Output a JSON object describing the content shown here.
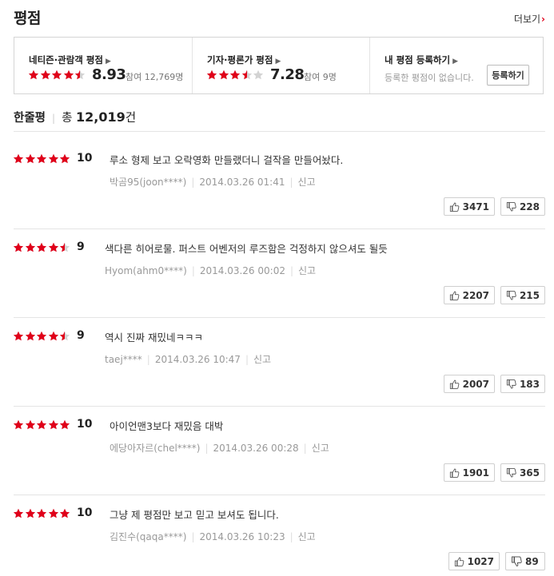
{
  "header": {
    "title": "평점",
    "more_label": "더보기",
    "more_arrow": "›"
  },
  "summary": {
    "netizen": {
      "label": "네티즌·관람객 평점",
      "score": "8.93",
      "sub": "참여 12,769명",
      "stars": [
        1,
        1,
        1,
        1,
        0.5
      ]
    },
    "critic": {
      "label": "기자·평론가 평점",
      "score": "7.28",
      "sub": "참여 9명",
      "stars": [
        1,
        1,
        1,
        0.5,
        0
      ]
    },
    "mine": {
      "label": "내 평점 등록하기",
      "empty": "등록한 평점이 없습니다.",
      "button": "등록하기"
    }
  },
  "count": {
    "label": "한줄평",
    "prefix": "총",
    "number": "12,019",
    "suffix": "건"
  },
  "colors": {
    "star_on": "#e0001a",
    "star_off": "#d3d3d3",
    "accent": "#e0001a"
  },
  "icons": {
    "up": "thumbs-up-icon",
    "down": "thumbs-down-icon"
  },
  "reviews": [
    {
      "stars": [
        1,
        1,
        1,
        1,
        1
      ],
      "score": "10",
      "text": "루소 형제 보고 오락영화 만들랬더니 걸작을 만들어놨다.",
      "user": "박곰95(joon****)",
      "date": "2014.03.26 01:41",
      "report": "신고",
      "up": "3471",
      "down": "228"
    },
    {
      "stars": [
        1,
        1,
        1,
        1,
        0.5
      ],
      "score": "9",
      "text": "색다른 히어로물. 퍼스트 어벤저의 루즈함은 걱정하지 않으셔도 될듯",
      "user": "Hyom(ahm0****)",
      "date": "2014.03.26 00:02",
      "report": "신고",
      "up": "2207",
      "down": "215"
    },
    {
      "stars": [
        1,
        1,
        1,
        1,
        0.5
      ],
      "score": "9",
      "text": "역시 진짜 재밌네ㅋㅋㅋ",
      "user": "taej****",
      "date": "2014.03.26 10:47",
      "report": "신고",
      "up": "2007",
      "down": "183"
    },
    {
      "stars": [
        1,
        1,
        1,
        1,
        1
      ],
      "score": "10",
      "text": "아이언맨3보다 재밌음 대박",
      "user": "에당아자르(chel****)",
      "date": "2014.03.26 00:28",
      "report": "신고",
      "up": "1901",
      "down": "365"
    },
    {
      "stars": [
        1,
        1,
        1,
        1,
        1
      ],
      "score": "10",
      "text": "그냥 제 평점만 보고 믿고 보셔도 됩니다.",
      "user": "김진수(qaqa****)",
      "date": "2014.03.26 10:23",
      "report": "신고",
      "up": "1027",
      "down": "89"
    }
  ]
}
